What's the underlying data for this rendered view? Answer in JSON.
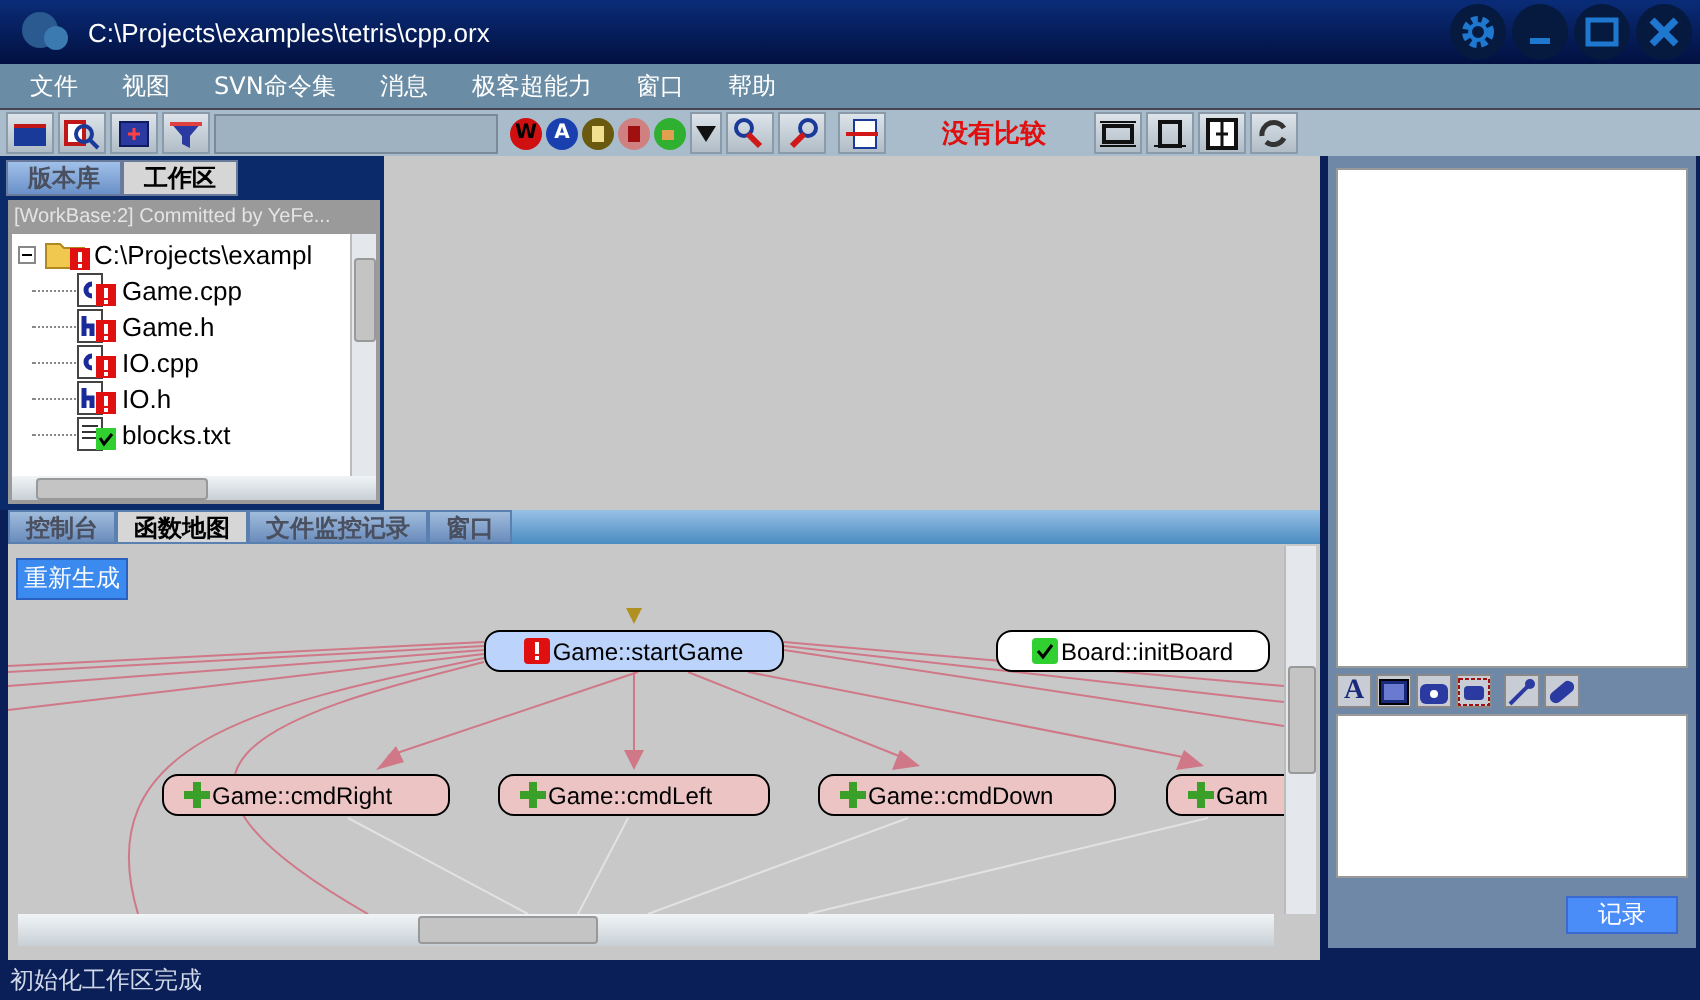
{
  "window": {
    "title": "C:\\Projects\\examples\\tetris\\cpp.orx"
  },
  "menu": [
    "文件",
    "视图",
    "SVN命令集",
    "消息",
    "极客超能力",
    "窗口",
    "帮助"
  ],
  "toolbar": {
    "icon_letters": [
      "W",
      "A"
    ],
    "compare_status": "没有比较"
  },
  "repo_tabs": [
    {
      "label": "版本库",
      "selected": false
    },
    {
      "label": "工作区",
      "selected": true
    }
  ],
  "workspace": {
    "header": "[WorkBase:2] Committed by YeFe...",
    "tree": [
      {
        "label": "C:\\Projects\\exampl",
        "kind": "folder",
        "modified": true,
        "expanded": true,
        "children": [
          {
            "label": "Game.cpp",
            "kind": "cpp",
            "modified": true
          },
          {
            "label": "Game.h",
            "kind": "h",
            "modified": true
          },
          {
            "label": "IO.cpp",
            "kind": "cpp",
            "modified": true
          },
          {
            "label": "IO.h",
            "kind": "h",
            "modified": true
          },
          {
            "label": "blocks.txt",
            "kind": "txt",
            "modified": false
          }
        ]
      }
    ]
  },
  "bottom_tabs": [
    {
      "label": "控制台",
      "selected": false
    },
    {
      "label": "函数地图",
      "selected": true
    },
    {
      "label": "文件监控记录",
      "selected": false
    },
    {
      "label": "窗口",
      "selected": false
    }
  ],
  "function_map": {
    "regenerate_button": "重新生成",
    "nodes": [
      {
        "label": "Game::startGame",
        "kind": "error",
        "selected": true
      },
      {
        "label": "Board::initBoard",
        "kind": "ok",
        "selected": false
      },
      {
        "label": "Game::cmdRight",
        "kind": "added",
        "selected": false
      },
      {
        "label": "Game::cmdLeft",
        "kind": "added",
        "selected": false
      },
      {
        "label": "Game::cmdDown",
        "kind": "added",
        "selected": false
      },
      {
        "label": "Gam",
        "kind": "added",
        "selected": false
      }
    ]
  },
  "right_panel": {
    "tool_letter": "A",
    "record_button": "记录"
  },
  "status_bar": "初始化工作区完成"
}
